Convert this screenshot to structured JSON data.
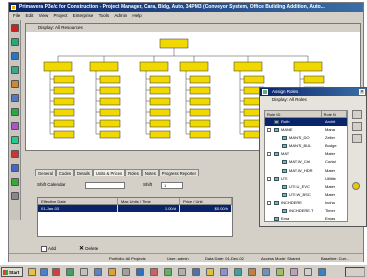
{
  "window": {
    "title": "Primavera P3e/c for Construction - Project Manager, Cara, Bldg, Auto, 34PM3 (Conveyor System, Office Building Addition, Auto..."
  },
  "menu": [
    "File",
    "Edit",
    "View",
    "Project",
    "Enterprise",
    "Tools",
    "Admin",
    "Help"
  ],
  "activities_panel": {
    "caption": "Display: All Resources"
  },
  "roles_dialog": {
    "title": "Assign Roles",
    "caption": "Display: All Roles",
    "headers": [
      "Role ID",
      "Role N"
    ],
    "rows": [
      {
        "id": "Roth",
        "name": "Archit",
        "selected": true
      },
      {
        "id": "MANE",
        "name": "Mana"
      },
      {
        "id": "MAN'S_DO",
        "name": "Zeller"
      },
      {
        "id": "MAN'S_BUL",
        "name": "Budge"
      },
      {
        "id": "MAT",
        "name": "Mater"
      },
      {
        "id": "MAT.W_Ctrl",
        "name": "Curtai"
      },
      {
        "id": "MAT.W_HDR",
        "name": "Mater"
      },
      {
        "id": "UTI",
        "name": "Utilitie"
      },
      {
        "id": "UTI.U_EVC",
        "name": "Mater"
      },
      {
        "id": "UTI.W_BSC",
        "name": "Mater"
      },
      {
        "id": "INCHDERE",
        "name": "Incha"
      },
      {
        "id": "INCHDERE.T",
        "name": "Timer"
      },
      {
        "id": "Ema",
        "name": "Emas"
      }
    ]
  },
  "details_panel": {
    "tabs": [
      "General",
      "Codes",
      "Details",
      "Units & Prices",
      "Roles",
      "Notes",
      "Progress Reporter"
    ],
    "shift_label": "Shift Calendar",
    "shift_value": "",
    "shift_label2": "Shift",
    "shift_value2": "1",
    "grid_headers": [
      "Effective Date",
      "Max Units / Time",
      "Price / Unit"
    ],
    "grid_rows": [
      {
        "date": "01-Jan-03",
        "units": "1.00/d",
        "price": "$0.00/h",
        "selected": true
      }
    ],
    "add_label": "Add",
    "delete_label": "Delete"
  },
  "status_bar": {
    "portfolio": "Portfolio: All Projects",
    "user": "User: admin",
    "data_date": "Data Date: 01-Dec-02",
    "access_mode": "Access Mode: Shared",
    "baseline": "Baseline: Curr..."
  },
  "taskbar": {
    "start_label": "Start",
    "clock": ""
  },
  "colors": {
    "node_fill": "#f0d800",
    "title_blue": "#0a246a",
    "selection": "#0a246a"
  }
}
